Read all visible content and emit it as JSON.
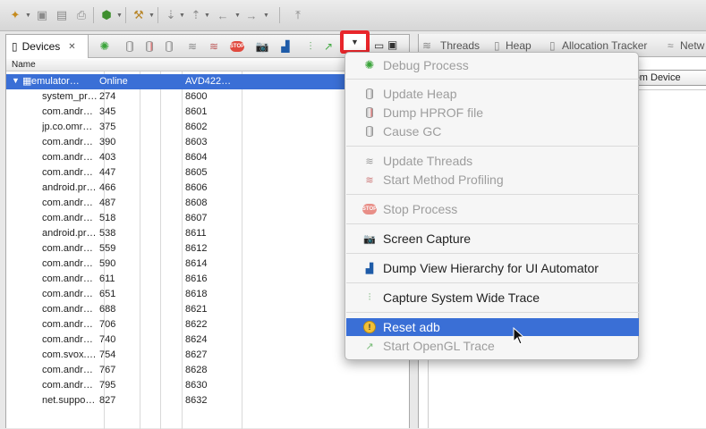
{
  "devices_tab": {
    "label": "Devices"
  },
  "right_tabs": [
    {
      "label": "Threads"
    },
    {
      "label": "Heap"
    },
    {
      "label": "Allocation Tracker"
    },
    {
      "label": "Netw"
    }
  ],
  "right_panel": {
    "from_device_label": "rom Device"
  },
  "grid": {
    "header_name": "Name",
    "device": {
      "name": "emulator…",
      "status": "Online",
      "avd": "AVD422…"
    },
    "processes": [
      {
        "name": "system_pr…",
        "pid": "274",
        "port": "8600"
      },
      {
        "name": "com.andr…",
        "pid": "345",
        "port": "8601"
      },
      {
        "name": "jp.co.omr…",
        "pid": "375",
        "port": "8602"
      },
      {
        "name": "com.andr…",
        "pid": "390",
        "port": "8603"
      },
      {
        "name": "com.andr…",
        "pid": "403",
        "port": "8604"
      },
      {
        "name": "com.andr…",
        "pid": "447",
        "port": "8605"
      },
      {
        "name": "android.pr…",
        "pid": "466",
        "port": "8606"
      },
      {
        "name": "com.andr…",
        "pid": "487",
        "port": "8608"
      },
      {
        "name": "com.andr…",
        "pid": "518",
        "port": "8607"
      },
      {
        "name": "android.pr…",
        "pid": "538",
        "port": "8611"
      },
      {
        "name": "com.andr…",
        "pid": "559",
        "port": "8612"
      },
      {
        "name": "com.andr…",
        "pid": "590",
        "port": "8614"
      },
      {
        "name": "com.andr…",
        "pid": "611",
        "port": "8616"
      },
      {
        "name": "com.andr…",
        "pid": "651",
        "port": "8618"
      },
      {
        "name": "com.andr…",
        "pid": "688",
        "port": "8621"
      },
      {
        "name": "com.andr…",
        "pid": "706",
        "port": "8622"
      },
      {
        "name": "com.andr…",
        "pid": "740",
        "port": "8624"
      },
      {
        "name": "com.svox.…",
        "pid": "754",
        "port": "8627"
      },
      {
        "name": "com.andr…",
        "pid": "767",
        "port": "8628"
      },
      {
        "name": "com.andr…",
        "pid": "795",
        "port": "8630"
      },
      {
        "name": "net.suppo…",
        "pid": "827",
        "port": "8632"
      }
    ]
  },
  "menu": {
    "debug_process": "Debug Process",
    "update_heap": "Update Heap",
    "dump_hprof": "Dump HPROF file",
    "cause_gc": "Cause GC",
    "update_threads": "Update Threads",
    "start_method_profiling": "Start Method Profiling",
    "stop_process": "Stop Process",
    "screen_capture": "Screen Capture",
    "dump_view_hierarchy": "Dump View Hierarchy for UI Automator",
    "capture_system_trace": "Capture System Wide Trace",
    "reset_adb": "Reset adb",
    "start_opengl_trace": "Start OpenGL Trace"
  },
  "stop_icon_text": "STOP"
}
